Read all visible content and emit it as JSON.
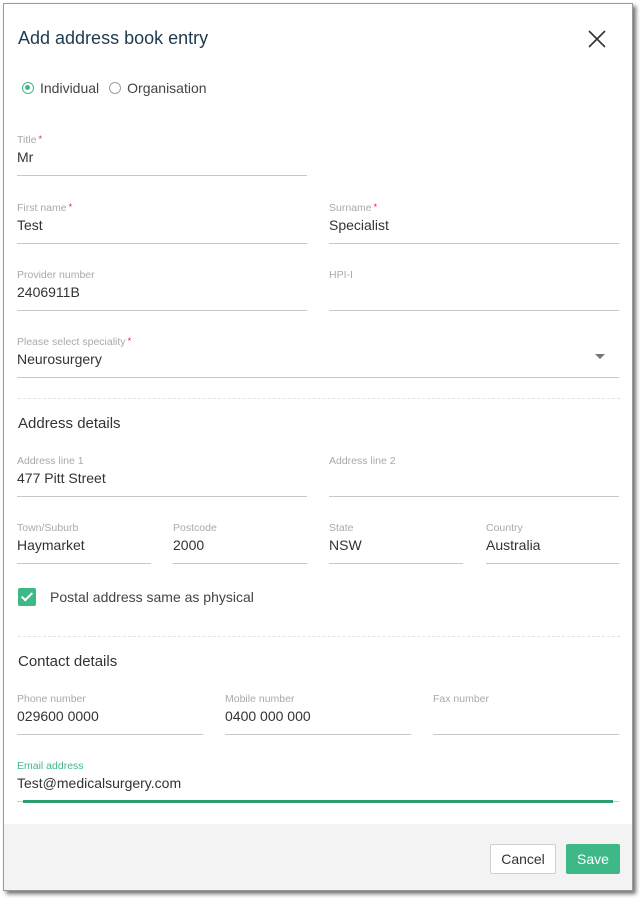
{
  "dialog": {
    "title": "Add address book entry",
    "close_icon": "close-icon"
  },
  "entry_type": {
    "options": [
      {
        "label": "Individual",
        "selected": true
      },
      {
        "label": "Organisation",
        "selected": false
      }
    ]
  },
  "fields": {
    "title": {
      "label": "Title",
      "required": "*",
      "value": "Mr"
    },
    "first_name": {
      "label": "First name",
      "required": "*",
      "value": "Test"
    },
    "surname": {
      "label": "Surname",
      "required": "*",
      "value": "Specialist"
    },
    "provider_number": {
      "label": "Provider number",
      "value": "2406911B"
    },
    "hpi_i": {
      "label": "HPI-I",
      "value": ""
    },
    "speciality": {
      "label": "Please select speciality",
      "required": "*",
      "value": "Neurosurgery"
    }
  },
  "address": {
    "heading": "Address details",
    "line1": {
      "label": "Address line 1",
      "value": "477 Pitt Street"
    },
    "line2": {
      "label": "Address line 2",
      "value": ""
    },
    "town": {
      "label": "Town/Suburb",
      "value": "Haymarket"
    },
    "postcode": {
      "label": "Postcode",
      "value": "2000"
    },
    "state": {
      "label": "State",
      "value": "NSW"
    },
    "country": {
      "label": "Country",
      "value": "Australia"
    },
    "postal_same": {
      "label": "Postal address same as physical",
      "checked": true
    }
  },
  "contact": {
    "heading": "Contact details",
    "phone": {
      "label": "Phone number",
      "value": "029600 0000"
    },
    "mobile": {
      "label": "Mobile number",
      "value": "0400 000 000"
    },
    "fax": {
      "label": "Fax number",
      "value": ""
    },
    "email": {
      "label": "Email address",
      "value": "Test@medicalsurgery.com"
    }
  },
  "footer": {
    "cancel_label": "Cancel",
    "save_label": "Save"
  },
  "colors": {
    "accent": "#3db886",
    "title": "#1f3a4d",
    "required": "#d9234a"
  }
}
